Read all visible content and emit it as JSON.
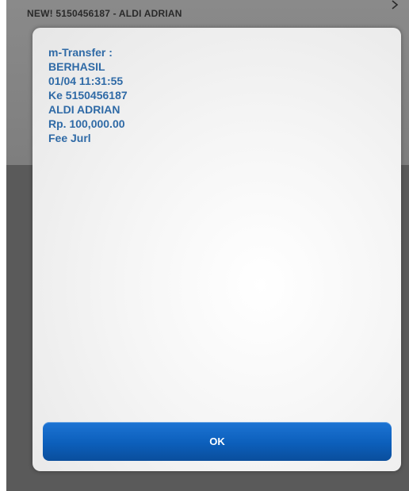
{
  "background": {
    "title": "NEW! 5150456187 - ALDI ADRIAN",
    "corner_icon": "chevron-icon"
  },
  "dialog": {
    "message_lines": [
      "m-Transfer :",
      "BERHASIL",
      "01/04 11:31:55",
      "Ke 5150456187",
      "ALDI ADRIAN",
      "Rp. 100,000.00",
      "Fee Jurl"
    ],
    "ok_label": "OK"
  },
  "colors": {
    "message_text": "#2f6aa6",
    "button": "#0c5fbb",
    "backdrop": "#5a5a5a"
  }
}
